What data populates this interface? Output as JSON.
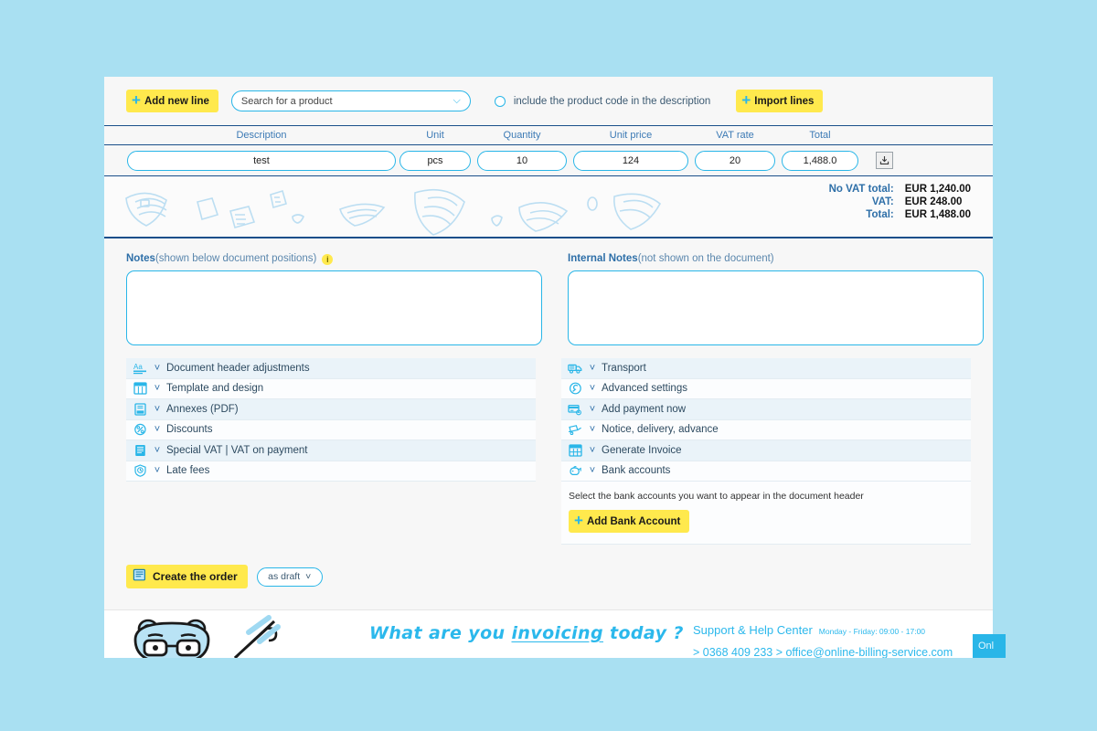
{
  "toolbar": {
    "add_new_line_label": "Add new line",
    "product_search_placeholder": "Search for a product",
    "include_code_label": "include the product code in the description",
    "import_lines_label": "Import lines"
  },
  "table": {
    "headers": {
      "description": "Description",
      "unit": "Unit",
      "quantity": "Quantity",
      "unit_price": "Unit price",
      "vat_rate": "VAT rate",
      "total": "Total"
    },
    "rows": [
      {
        "description": "test",
        "unit": "pcs",
        "quantity": "10",
        "unit_price": "124",
        "vat_rate": "20",
        "total": "1,488.0"
      }
    ]
  },
  "totals": {
    "no_vat_label": "No VAT total:",
    "no_vat_value": "EUR 1,240.00",
    "vat_label": "VAT:",
    "vat_value": "EUR 248.00",
    "total_label": "Total:",
    "total_value": "EUR 1,488.00"
  },
  "notes": {
    "title": "Notes",
    "subtitle": "(shown below document positions)",
    "info_glyph": "i",
    "value": ""
  },
  "internal_notes": {
    "title": "Internal Notes",
    "subtitle": "(not shown on the document)",
    "value": ""
  },
  "left_accordion": [
    {
      "label": "Document header adjustments",
      "icon": "text-format-icon"
    },
    {
      "label": "Template and design",
      "icon": "template-grid-icon"
    },
    {
      "label": "Annexes (PDF)",
      "icon": "pdf-document-icon"
    },
    {
      "label": "Discounts",
      "icon": "discount-tag-icon"
    },
    {
      "label": "Special VAT | VAT on payment",
      "icon": "vat-document-icon"
    },
    {
      "label": "Late fees",
      "icon": "clock-shield-icon"
    }
  ],
  "right_accordion": [
    {
      "label": "Transport",
      "icon": "truck-icon"
    },
    {
      "label": "Advanced settings",
      "icon": "wrench-icon"
    },
    {
      "label": "Add payment now",
      "icon": "payment-card-icon"
    },
    {
      "label": "Notice, delivery, advance",
      "icon": "delivery-cart-icon"
    },
    {
      "label": "Generate Invoice",
      "icon": "invoice-grid-icon"
    },
    {
      "label": "Bank accounts",
      "icon": "piggy-bank-icon"
    }
  ],
  "bank_panel": {
    "hint": "Select the bank accounts you want to appear in the document header",
    "add_button_label": "Add Bank Account"
  },
  "actions": {
    "create_label": "Create the order",
    "draft_label": "as draft"
  },
  "footer": {
    "slogan_part1": "What are you ",
    "slogan_underlined": "invoicing",
    "slogan_part2": " today ?",
    "support_title": "Support & Help Center",
    "support_hours": "Monday - Friday: 09:00 - 17:00",
    "support_contact": "> 0368 409 233 > office@online-billing-service.com",
    "online_badge": "Onl"
  },
  "colors": {
    "page_background": "#a9e0f2",
    "accent_blue": "#29b6e8",
    "accent_yellow": "#ffe94d",
    "dark_blue": "#1a4f8a",
    "text_blue": "#2e6fa8"
  }
}
